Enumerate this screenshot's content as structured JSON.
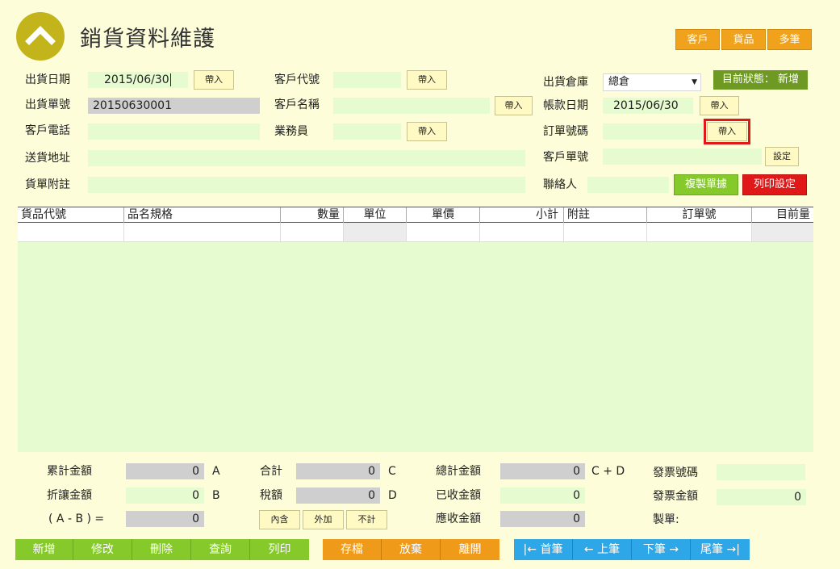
{
  "header": {
    "title": "銷貨資料維護",
    "btn_customer": "客戶",
    "btn_goods": "貨品",
    "btn_multi": "多筆",
    "status": "目前狀態： 新增"
  },
  "form": {
    "ship_date_label": "出貨日期",
    "ship_date_value": "2015/06/30",
    "ship_no_label": "出貨單號",
    "ship_no_value": "20150630001",
    "cust_phone_label": "客戶電話",
    "address_label": "送貨地址",
    "note_label": "貨單附註",
    "cust_code_label": "客戶代號",
    "cust_name_label": "客戶名稱",
    "salesman_label": "業務員",
    "warehouse_label": "出貨倉庫",
    "warehouse_value": "總倉",
    "account_date_label": "帳款日期",
    "account_date_value": "2015/06/30",
    "order_no_label": "訂單號碼",
    "cust_doc_label": "客戶單號",
    "contact_label": "聯絡人",
    "import": "帶入",
    "setting": "設定",
    "copy_doc": "複製單據",
    "print_setting": "列印設定"
  },
  "table": {
    "columns": [
      "貨品代號",
      "品名規格",
      "數量",
      "單位",
      "單價",
      "小計",
      "附註",
      "訂單號",
      "目前量"
    ]
  },
  "summary": {
    "acc_amount_label": "累計金額",
    "acc_amount_value": "0",
    "a": "A",
    "discount_label": "折讓金額",
    "discount_value": "0",
    "b": "B",
    "amb_label": "( A - B ) =",
    "amb_value": "0",
    "total_label": "合計",
    "total_value": "0",
    "c": "C",
    "tax_label": "稅額",
    "tax_value": "0",
    "d": "D",
    "tax_incl": "內含",
    "tax_add": "外加",
    "tax_none": "不計",
    "grand_label": "總計金額",
    "grand_value": "0",
    "cd": "C + D",
    "received_label": "已收金額",
    "received_value": "0",
    "receivable_label": "應收金額",
    "receivable_value": "0",
    "invoice_no_label": "發票號碼",
    "invoice_amt_label": "發票金額",
    "invoice_amt_value": "0",
    "maker_label": "製單:"
  },
  "actions": {
    "new": "新增",
    "edit": "修改",
    "delete": "刪除",
    "query": "查詢",
    "print": "列印",
    "save": "存檔",
    "discard": "放棄",
    "exit": "離開",
    "first": "|← 首筆",
    "prev": "← 上筆",
    "next": "下筆 →",
    "last": "尾筆 →|"
  }
}
